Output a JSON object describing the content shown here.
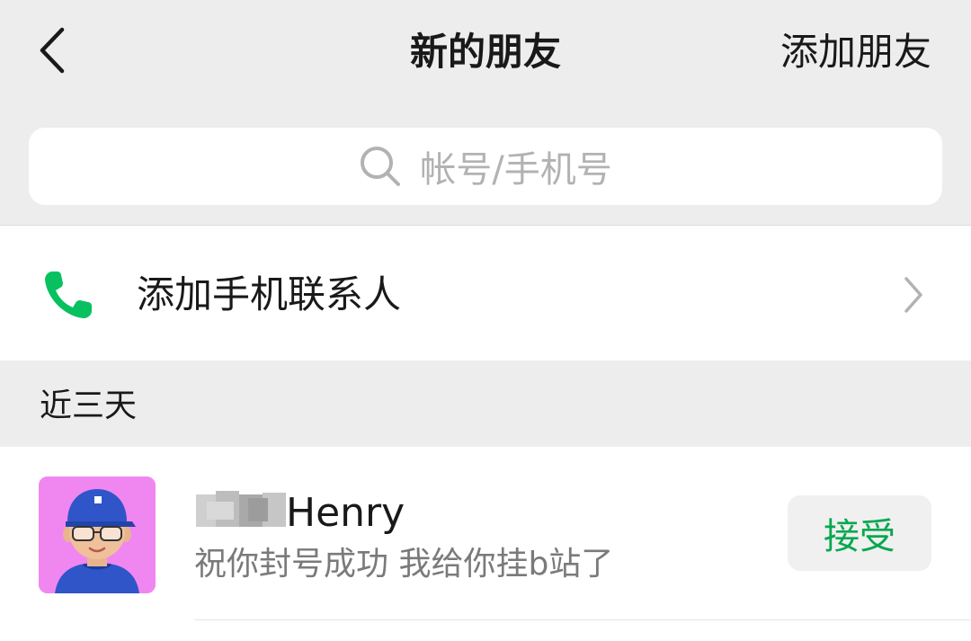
{
  "navbar": {
    "title": "新的朋友",
    "action_label": "添加朋友",
    "back_icon": "chevron-left-icon"
  },
  "search": {
    "placeholder": "帐号/手机号",
    "icon": "search-icon"
  },
  "phone_contacts": {
    "label": "添加手机联系人",
    "icon": "phone-icon",
    "icon_color": "#07c160"
  },
  "section": {
    "title": "近三天"
  },
  "requests": [
    {
      "name": "Henry",
      "message": "祝你封号成功 我给你挂b站了",
      "accept_label": "接受",
      "accent_color": "#07a84f"
    }
  ]
}
